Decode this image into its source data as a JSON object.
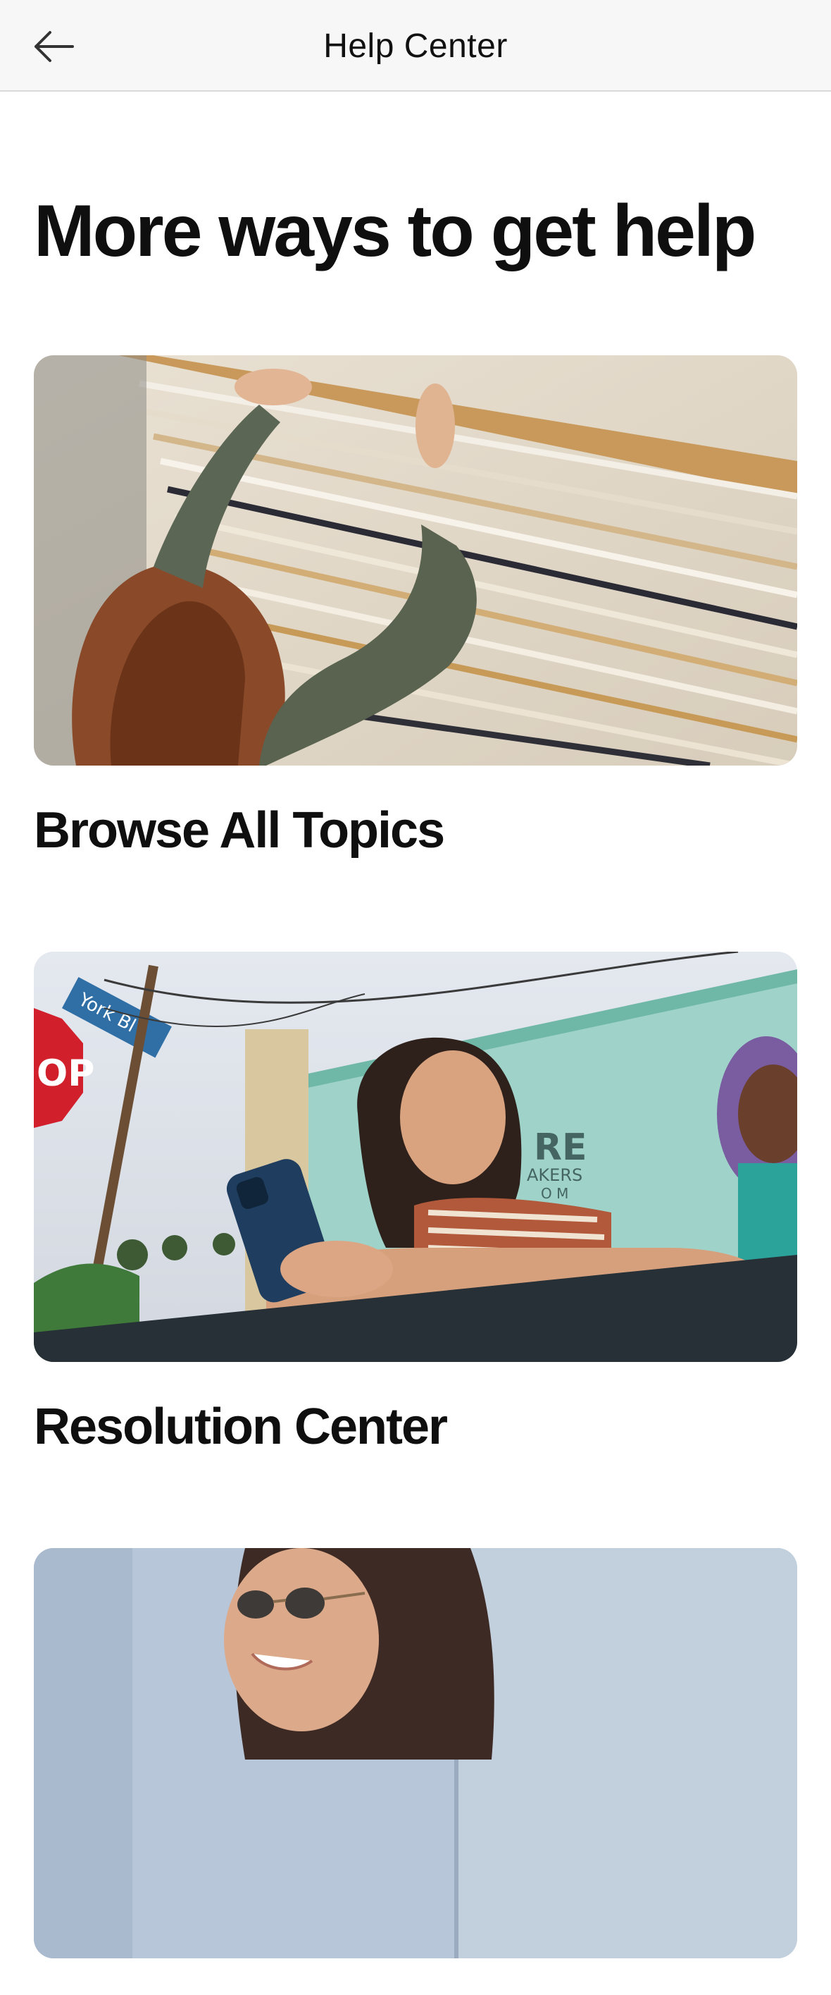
{
  "header": {
    "title": "Help Center",
    "back_icon": "arrow-left-icon"
  },
  "main": {
    "heading": "More ways to get help",
    "cards": [
      {
        "title": "Browse All Topics",
        "image": "person-reaching-for-paper-stacks-photo"
      },
      {
        "title": "Resolution Center",
        "image": "woman-smiling-at-phone-outdoors-photo"
      },
      {
        "title": "",
        "image": "woman-with-sunglasses-smiling-photo"
      }
    ]
  },
  "colors": {
    "header_bg": "#f7f7f7",
    "text": "#111111",
    "divider": "#d9d9d9"
  }
}
